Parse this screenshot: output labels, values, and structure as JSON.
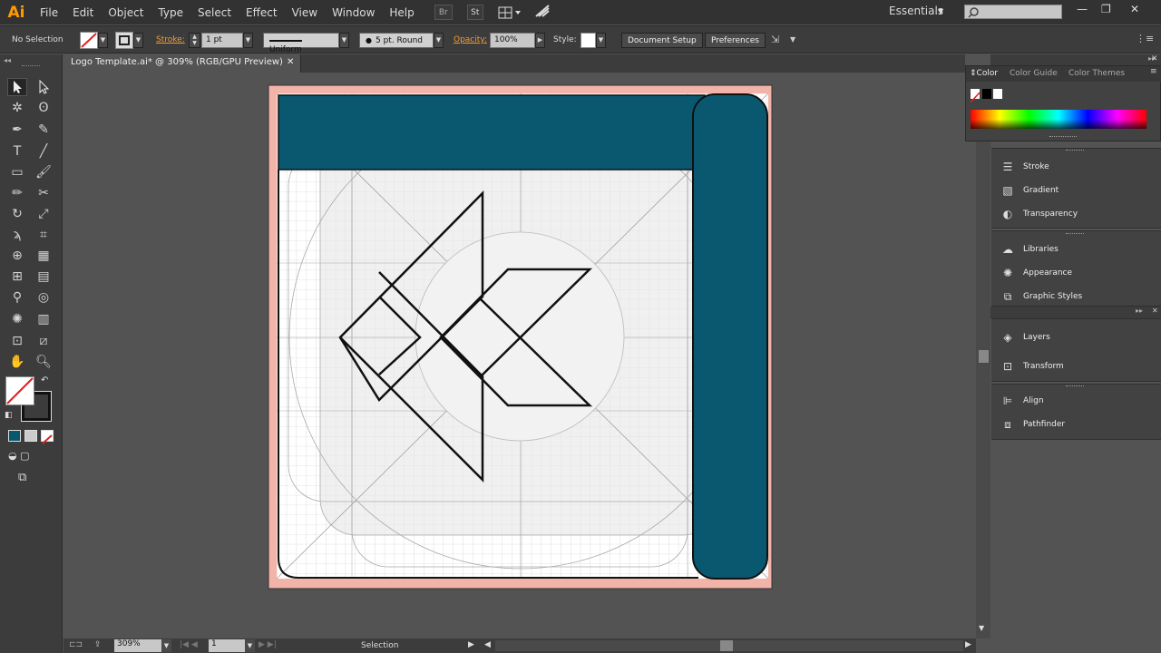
{
  "menubar": {
    "app_logo": "Ai",
    "items": [
      "File",
      "Edit",
      "Object",
      "Type",
      "Select",
      "Effect",
      "View",
      "Window",
      "Help"
    ],
    "br_label": "Br",
    "st_label": "St",
    "workspace": "Essentials"
  },
  "controlbar": {
    "selection_label": "No Selection",
    "stroke_label": "Stroke:",
    "stroke_weight": "1 pt",
    "profile": "Uniform",
    "brush": "5 pt. Round",
    "opacity_label": "Opacity:",
    "opacity_value": "100%",
    "style_label": "Style:",
    "document_setup": "Document Setup",
    "preferences": "Preferences"
  },
  "document": {
    "tab_title": "Logo Template.ai* @ 309% (RGB/GPU Preview)"
  },
  "color_panel": {
    "tabs": [
      "Color",
      "Color Guide",
      "Color Themes"
    ]
  },
  "panels": {
    "group1": [
      "Stroke",
      "Gradient",
      "Transparency"
    ],
    "group2": [
      "Libraries",
      "Appearance",
      "Graphic Styles"
    ],
    "group3": [
      "Layers",
      "Transform"
    ],
    "group4": [
      "Align",
      "Pathfinder"
    ]
  },
  "statusbar": {
    "zoom": "309%",
    "page": "1",
    "tool_name": "Selection"
  },
  "colors": {
    "accent_teal": "#0a5870",
    "artboard_bleed": "#f2b3a8",
    "menu_bg": "#323232",
    "panel_bg": "#3c3c3c",
    "canvas_bg": "#535353"
  }
}
